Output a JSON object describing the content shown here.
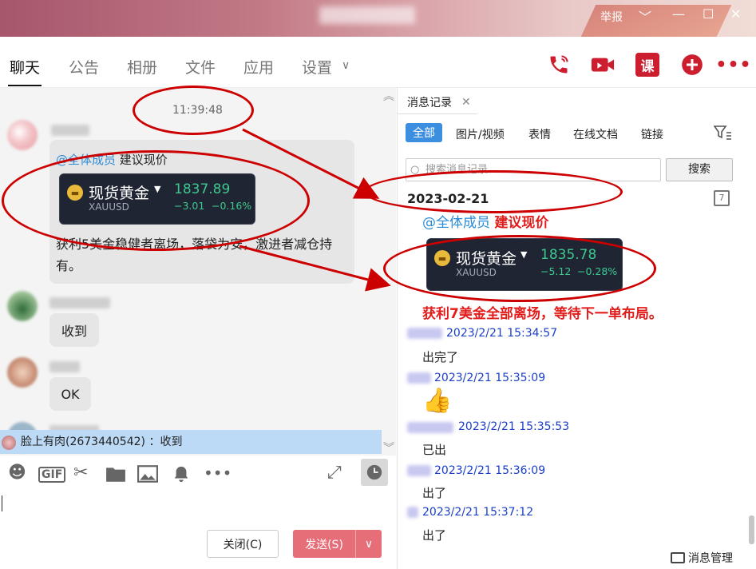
{
  "titlebar": {
    "report": "举报"
  },
  "tabs": [
    "聊天",
    "公告",
    "相册",
    "文件",
    "应用",
    "设置"
  ],
  "chat": {
    "time": "11:39:48",
    "msg1": {
      "mention": "@全体成员",
      "text": "建议现价",
      "gold_name": "现货黄金",
      "gold_symbol": "XAUUSD",
      "price": "1837.89",
      "change": "−3.01",
      "change_pct": "−0.16%",
      "body": "获利5美金稳健者离场，落袋为安，激进者减仓持有。"
    },
    "msg2": "收到",
    "msg3": "OK",
    "notice": "脸上有肉(2673440542) ：收到"
  },
  "buttons": {
    "close": "关闭(C)",
    "send": "发送(S)"
  },
  "history": {
    "tab_title": "消息记录",
    "filters": [
      "全部",
      "图片/视频",
      "表情",
      "在线文档",
      "链接"
    ],
    "search_placeholder": "搜索消息记录",
    "search_btn": "搜索",
    "date": "2023-02-21",
    "post": {
      "mention": "@全体成员",
      "text": "建议现价",
      "gold_name": "现货黄金",
      "gold_symbol": "XAUUSD",
      "price": "1835.78",
      "change": "−5.12",
      "change_pct": "−0.28%",
      "body": "获利7美金全部离场，等待下一单布局。"
    },
    "messages": [
      {
        "time": "2023/2/21 15:34:57",
        "text": "出完了"
      },
      {
        "time": "2023/2/21 15:35:09",
        "text": "👍"
      },
      {
        "time": "2023/2/21 15:35:53",
        "text": "已出"
      },
      {
        "time": "2023/2/21 15:36:09",
        "text": "出了"
      },
      {
        "time": "2023/2/21 15:37:12",
        "text": "出了"
      }
    ],
    "manage": "消息管理"
  },
  "colors": {
    "accent_red": "#cc1e2f",
    "annotation_red": "#cc0000",
    "tab_blue": "#3c8ee0"
  }
}
